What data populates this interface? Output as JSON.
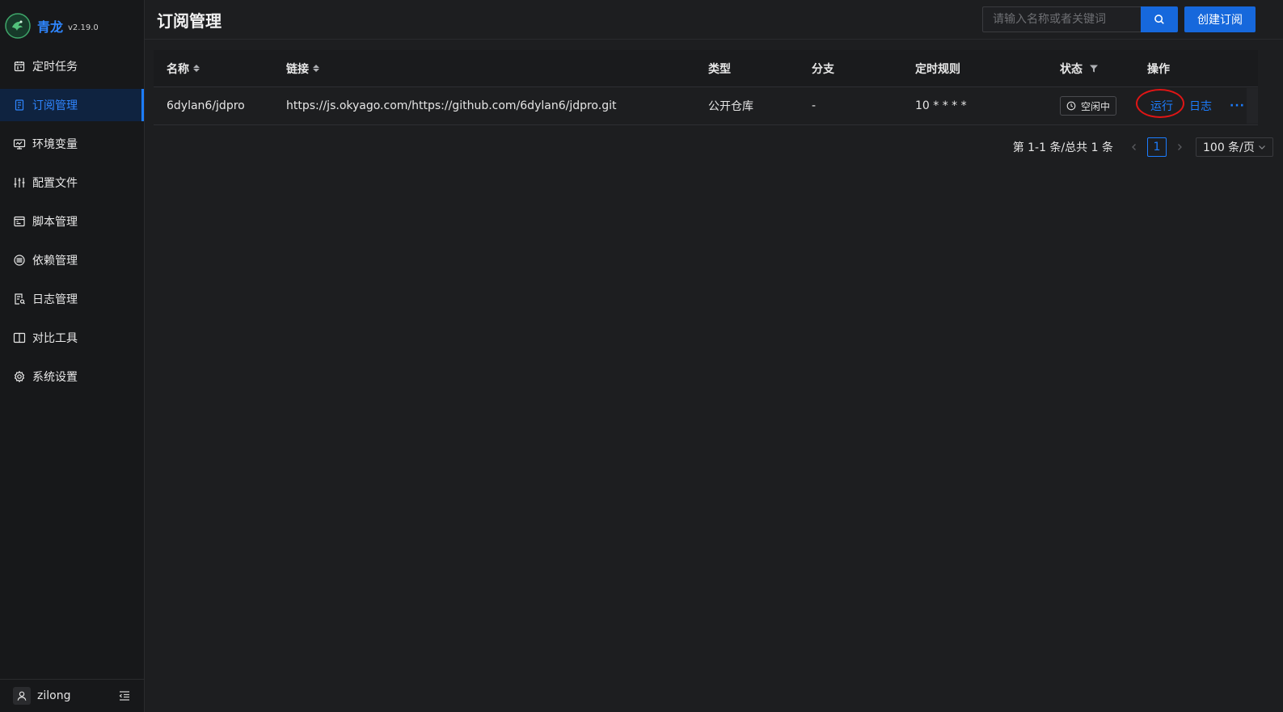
{
  "app": {
    "name": "青龙",
    "version": "v2.19.0"
  },
  "sidebar": {
    "items": [
      {
        "label": "定时任务",
        "icon": "calendar-icon"
      },
      {
        "label": "订阅管理",
        "icon": "subscription-icon"
      },
      {
        "label": "环境变量",
        "icon": "monitor-icon"
      },
      {
        "label": "配置文件",
        "icon": "sliders-icon"
      },
      {
        "label": "脚本管理",
        "icon": "script-icon"
      },
      {
        "label": "依赖管理",
        "icon": "dependency-icon"
      },
      {
        "label": "日志管理",
        "icon": "log-icon"
      },
      {
        "label": "对比工具",
        "icon": "diff-icon"
      },
      {
        "label": "系统设置",
        "icon": "gear-icon"
      }
    ],
    "active_index": 1,
    "user": {
      "name": "zilong"
    }
  },
  "header": {
    "title": "订阅管理",
    "search_placeholder": "请输入名称或者关键词",
    "create_label": "创建订阅"
  },
  "table": {
    "columns": {
      "name": "名称",
      "url": "链接",
      "type": "类型",
      "branch": "分支",
      "cron": "定时规则",
      "status": "状态",
      "ops": "操作"
    },
    "rows": [
      {
        "name": "6dylan6/jdpro",
        "url": "https://js.okyago.com/https://github.com/6dylan6/jdpro.git",
        "type": "公开仓库",
        "branch": "-",
        "cron": "10 * * * *",
        "status": "空闲中",
        "op_run": "运行",
        "op_log": "日志",
        "op_more": "···"
      }
    ]
  },
  "pagination": {
    "total_text": "第 1-1 条/总共 1 条",
    "current_page": "1",
    "page_size": "100 条/页"
  },
  "colors": {
    "accent": "#1c7dff",
    "highlight_circle": "#e01515"
  }
}
